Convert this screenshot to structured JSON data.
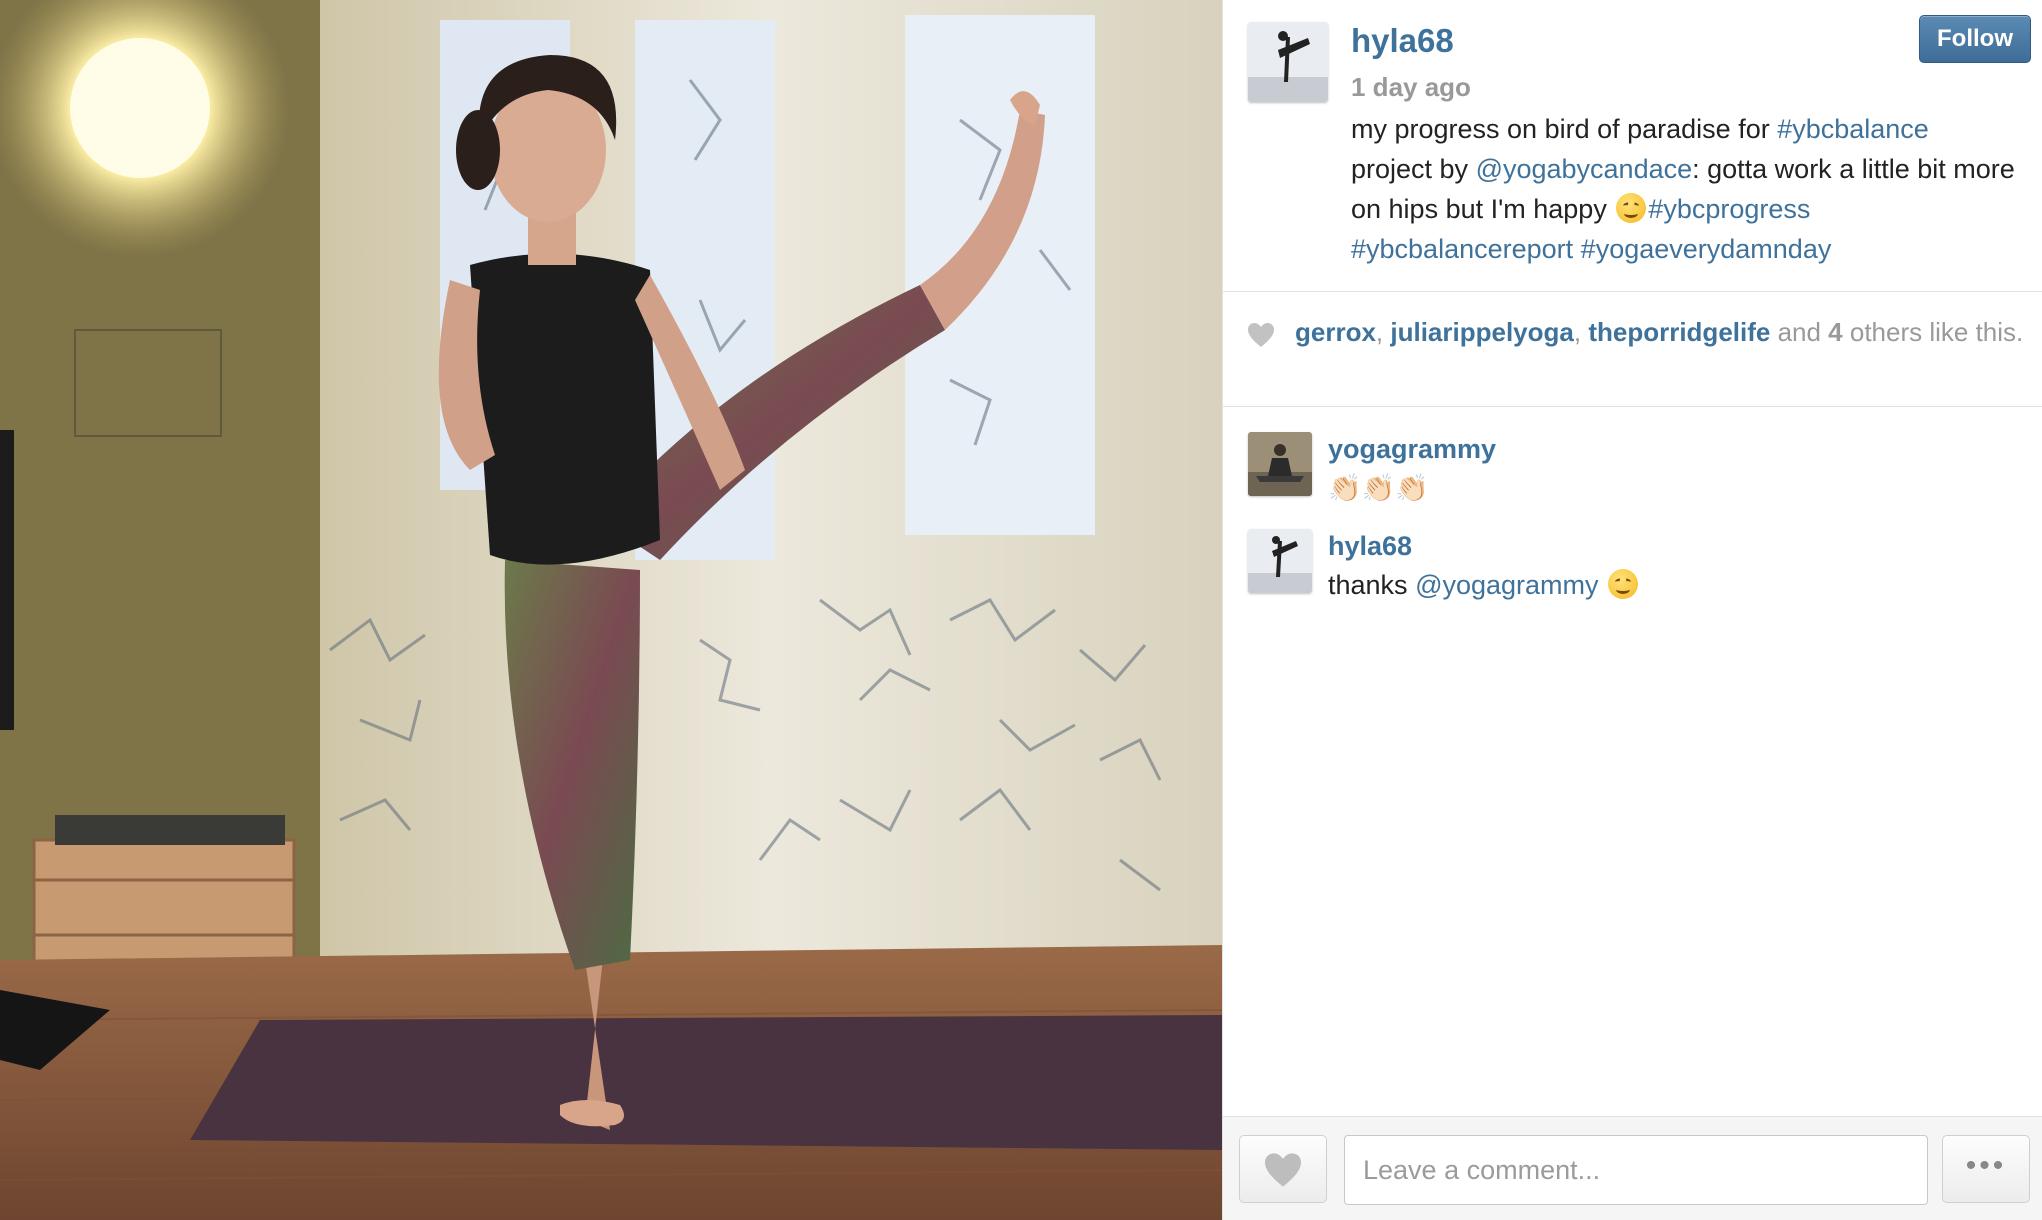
{
  "post": {
    "owner": "hyla68",
    "time": "1 day ago",
    "follow_label": "Follow",
    "caption": {
      "l1_text": "my progress on bird of paradise for ",
      "l1_tag": "#ybcbalance",
      "l2_text": "project by ",
      "l2_mention": "@yogabycandace",
      "l2_rest": ": gotta work a little bit more",
      "l3_text": "on hips but I'm happy ",
      "l3_tag": "#ybcprogress",
      "l4_tag1": "#ybcbalancereport",
      "l4_tag2": "#yogaeverydamnday"
    }
  },
  "likes": {
    "user1": "gerrox",
    "sep1": ", ",
    "user2": "juliarippelyoga",
    "sep2": ", ",
    "user3": "theporridgelife",
    "and": " and ",
    "count": "4",
    "rest": " others like this."
  },
  "comments": [
    {
      "user": "yogagrammy",
      "text": "👏🏻👏🏻👏🏻"
    },
    {
      "user": "hyla68",
      "text": "thanks ",
      "mention": "@yogagrammy"
    }
  ],
  "composer": {
    "placeholder": "Leave a comment...",
    "more_label": "•••"
  },
  "icons": {
    "like": "heart-icon",
    "more": "ellipsis-icon",
    "emoji": "smiling-face-emoji"
  },
  "colors": {
    "link": "#3f729b",
    "muted": "#999999",
    "follow_button": "#4a7aa6"
  }
}
